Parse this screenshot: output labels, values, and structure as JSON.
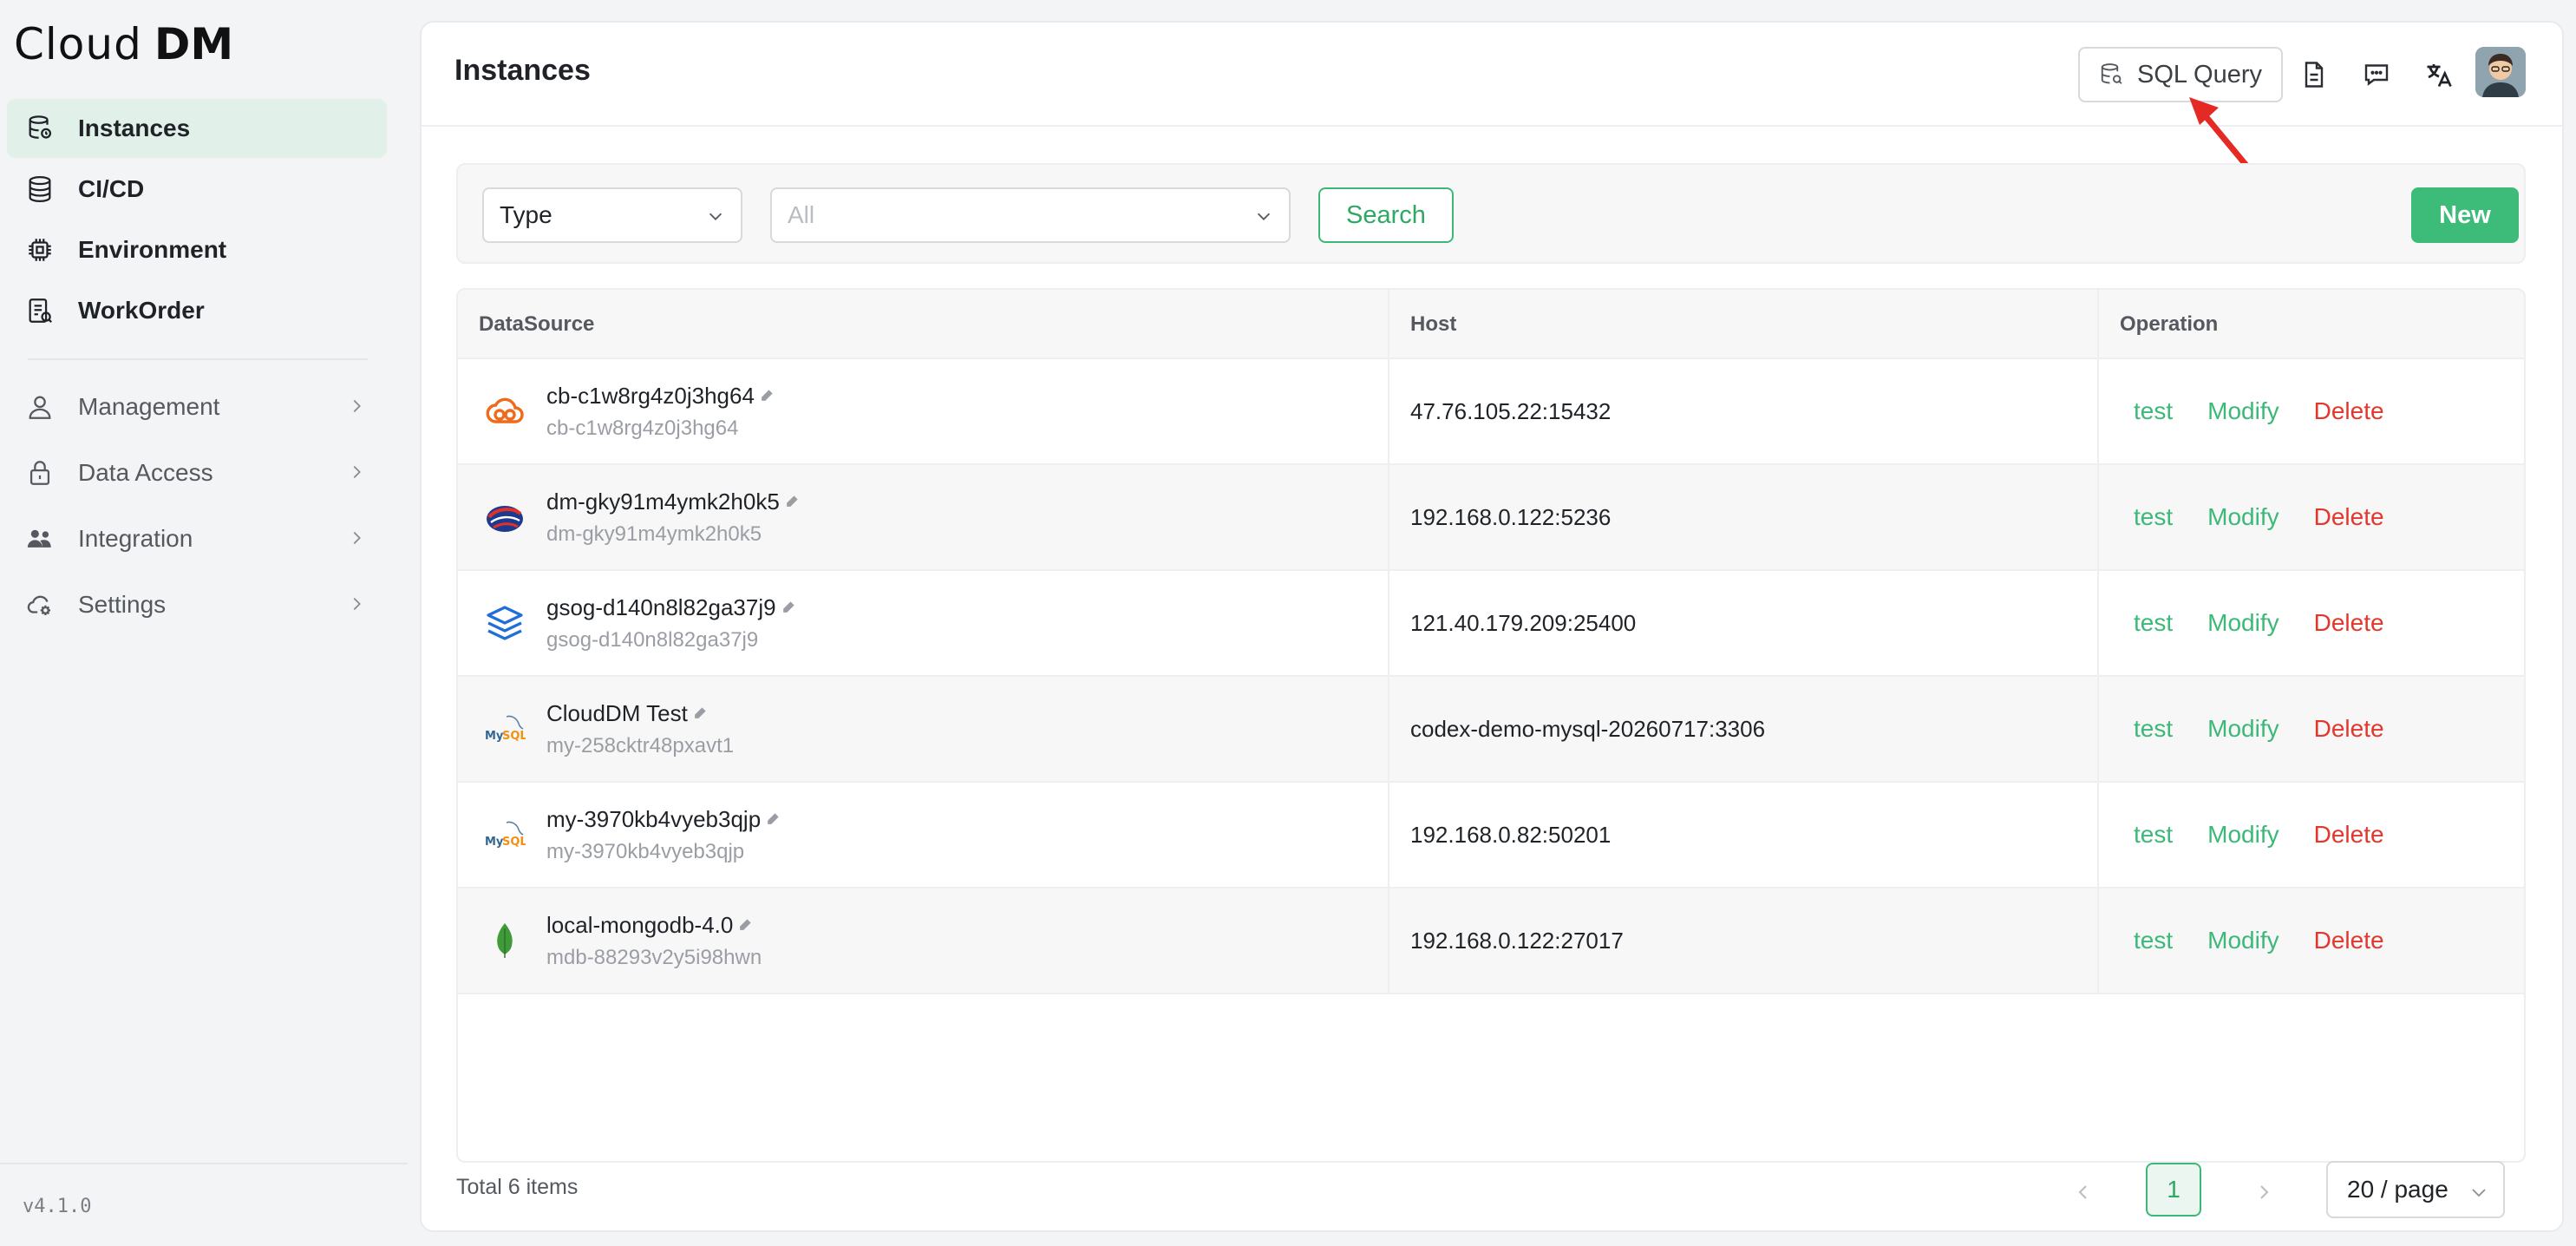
{
  "app": {
    "logo_main": "Cloud",
    "logo_sub": "DM",
    "version": "v4.1.0"
  },
  "sidebar": {
    "primary": [
      {
        "label": "Instances",
        "icon": "database-icon",
        "active": true
      },
      {
        "label": "CI/CD",
        "icon": "stack-icon",
        "active": false
      },
      {
        "label": "Environment",
        "icon": "chip-icon",
        "active": false
      },
      {
        "label": "WorkOrder",
        "icon": "clipboard-icon",
        "active": false
      }
    ],
    "secondary": [
      {
        "label": "Management",
        "icon": "user-icon"
      },
      {
        "label": "Data Access",
        "icon": "lock-icon"
      },
      {
        "label": "Integration",
        "icon": "team-icon"
      },
      {
        "label": "Settings",
        "icon": "cloud-gear-icon"
      }
    ]
  },
  "header": {
    "title": "Instances",
    "sql_query_label": "SQL Query",
    "icons": [
      "document-icon",
      "message-icon",
      "translate-icon",
      "avatar"
    ]
  },
  "filters": {
    "type_value": "Type",
    "all_placeholder": "All",
    "search_label": "Search",
    "new_label": "New"
  },
  "table": {
    "columns": [
      "DataSource",
      "Host",
      "Operation"
    ],
    "rows": [
      {
        "name": "cb-c1w8rg4z0j3hg64",
        "id": "cb-c1w8rg4z0j3hg64",
        "host": "47.76.105.22:15432",
        "icon": "cloud-db-icon"
      },
      {
        "name": "dm-gky91m4ymk2h0k5",
        "id": "dm-gky91m4ymk2h0k5",
        "host": "192.168.0.122:5236",
        "icon": "dameng-icon"
      },
      {
        "name": "gsog-d140n8l82ga37j9",
        "id": "gsog-d140n8l82ga37j9",
        "host": "121.40.179.209:25400",
        "icon": "layers-icon"
      },
      {
        "name": "CloudDM Test",
        "id": "my-258cktr48pxavt1",
        "host": "codex-demo-mysql-20260717:3306",
        "icon": "mysql-icon"
      },
      {
        "name": "my-3970kb4vyeb3qjp",
        "id": "my-3970kb4vyeb3qjp",
        "host": "192.168.0.82:50201",
        "icon": "mysql-icon"
      },
      {
        "name": "local-mongodb-4.0",
        "id": "mdb-88293v2y5i98hwn",
        "host": "192.168.0.122:27017",
        "icon": "mongodb-leaf-icon"
      }
    ],
    "ops": {
      "test": "test",
      "modify": "Modify",
      "delete": "Delete"
    }
  },
  "footer": {
    "total": "Total 6 items",
    "current_page": "1",
    "page_size": "20 / page"
  },
  "colors": {
    "accent": "#3dbb78",
    "danger": "#e3372d",
    "active_nav_bg": "#e1f1e9"
  }
}
